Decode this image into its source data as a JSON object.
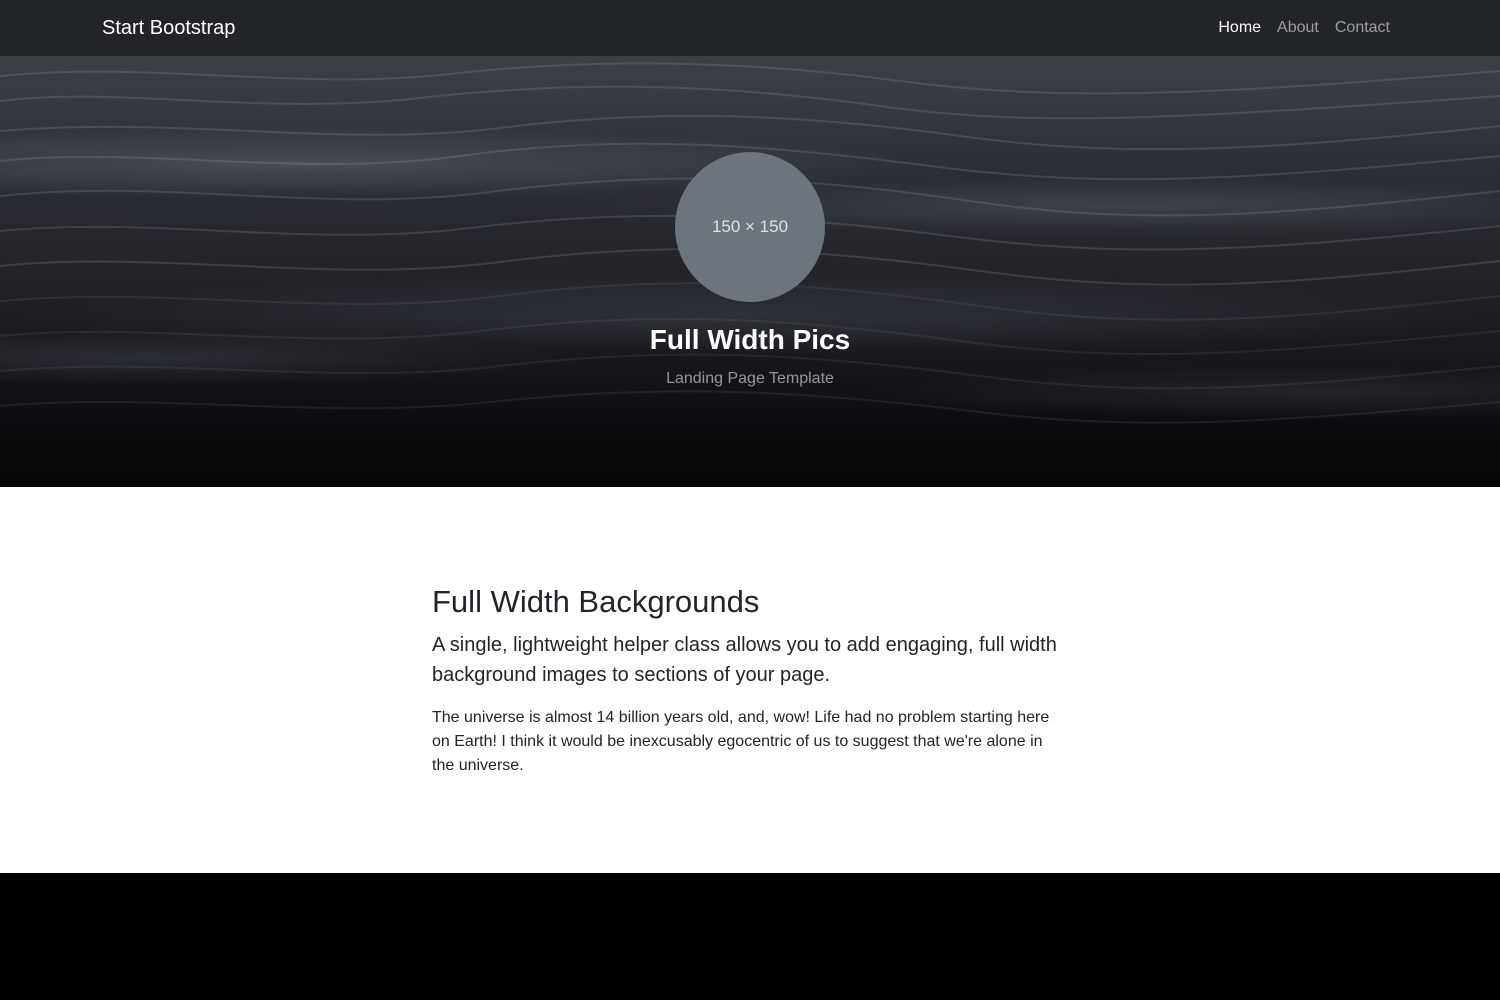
{
  "navbar": {
    "brand": "Start Bootstrap",
    "links": [
      {
        "label": "Home",
        "active": true
      },
      {
        "label": "About",
        "active": false
      },
      {
        "label": "Contact",
        "active": false
      }
    ]
  },
  "hero": {
    "avatar_placeholder": "150 × 150",
    "title": "Full Width Pics",
    "subtitle": "Landing Page Template"
  },
  "content": {
    "heading": "Full Width Backgrounds",
    "lead": "A single, lightweight helper class allows you to add engaging, full width background images to sections of your page.",
    "body": "The universe is almost 14 billion years old, and, wow! Life had no problem starting here on Earth! I think it would be inexcusably egocentric of us to suggest that we're alone in the universe."
  },
  "colors": {
    "navbar_bg": "#212529",
    "avatar_bg": "#6c757d",
    "footer_bg": "#000000",
    "text_dark": "#212529"
  }
}
